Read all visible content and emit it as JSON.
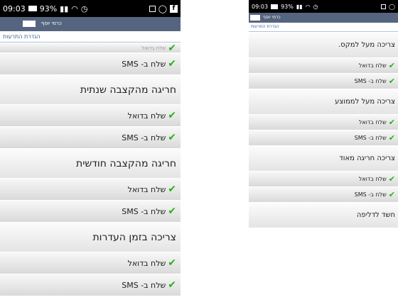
{
  "left": {
    "status": {
      "time": "09:03",
      "battery": "93%"
    },
    "appbar": {
      "title": "כרמי יוסף"
    },
    "subheader": "הגדרת התרעות",
    "rows": [
      {
        "kind": "partial",
        "check": true,
        "label": "שלח בדואל"
      },
      {
        "kind": "sub",
        "check": true,
        "label": "שלח ב- SMS"
      },
      {
        "kind": "head",
        "check": false,
        "label": "חריגה מהקצבה שנתית"
      },
      {
        "kind": "sub",
        "check": true,
        "label": "שלח בדואל"
      },
      {
        "kind": "sub",
        "check": true,
        "label": "שלח ב- SMS"
      },
      {
        "kind": "head",
        "check": false,
        "label": "חריגה מהקצבה חודשית"
      },
      {
        "kind": "sub",
        "check": true,
        "label": "שלח בדואל"
      },
      {
        "kind": "sub",
        "check": true,
        "label": "שלח ב- SMS"
      },
      {
        "kind": "head",
        "check": false,
        "label": "צריכה בזמן העדרות"
      },
      {
        "kind": "sub",
        "check": true,
        "label": "שלח בדואל"
      },
      {
        "kind": "sub",
        "check": true,
        "label": "שלח ב- SMS"
      }
    ]
  },
  "right": {
    "status": {
      "time": "09:03",
      "battery": "93%"
    },
    "appbar": {
      "title": "כרמי יוסף"
    },
    "subheader": "הגדרת התרעות",
    "rows": [
      {
        "kind": "head",
        "check": false,
        "label": "צריכה מעל למקס."
      },
      {
        "kind": "sub",
        "check": true,
        "label": "שלח בדואל"
      },
      {
        "kind": "sub",
        "check": true,
        "label": "שלח ב- SMS"
      },
      {
        "kind": "head",
        "check": false,
        "label": "צריכה מעל לממוצע"
      },
      {
        "kind": "sub",
        "check": true,
        "label": "שלח בדואל"
      },
      {
        "kind": "sub",
        "check": true,
        "label": "שלח ב- SMS"
      },
      {
        "kind": "head",
        "check": false,
        "label": "צריכה חריגה מאוד"
      },
      {
        "kind": "sub",
        "check": true,
        "label": "שלח בדואל"
      },
      {
        "kind": "sub",
        "check": true,
        "label": "שלח ב- SMS"
      },
      {
        "kind": "head",
        "check": false,
        "label": "חשד לדליפה"
      }
    ]
  },
  "icons": {
    "check": "check-icon",
    "battery": "battery-icon",
    "signal": "signal-icon",
    "wifi": "wifi-icon",
    "alarm": "alarm-icon",
    "gallery": "gallery-icon",
    "whatsapp": "whatsapp-icon",
    "facebook": "facebook-icon"
  },
  "colors": {
    "check": "#27b11d",
    "appbar": "#56657f",
    "subheader_text": "#2f5b9a"
  }
}
